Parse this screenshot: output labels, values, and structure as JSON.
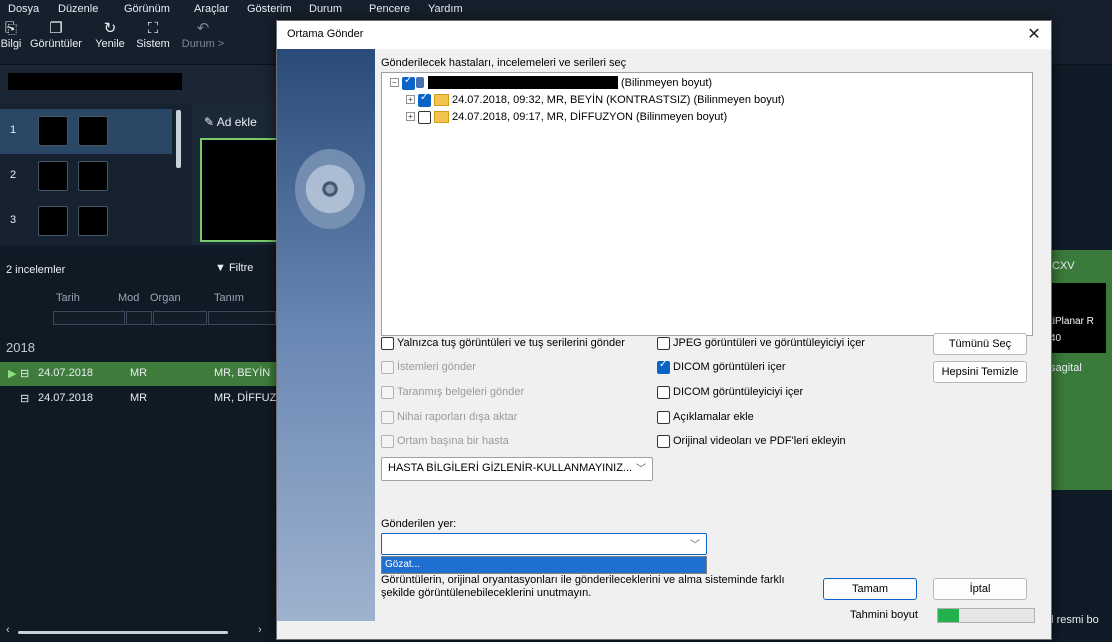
{
  "menu": [
    "Dosya",
    "Düzenle",
    "Görünüm",
    "Araçlar",
    "Gösterim",
    "Durum",
    "Pencere",
    "Yardım"
  ],
  "toolbar": {
    "bilgi": "Bilgi",
    "goruntuler": "Görüntüler",
    "yenile": "Yenile",
    "sistem": "Sistem",
    "durum": "Durum >"
  },
  "series": [
    "1",
    "2",
    "3"
  ],
  "viewer": {
    "add_label": "Ad ekle"
  },
  "study_list": {
    "count_label": "2 incelemler",
    "filter_label": "Filtre",
    "headers": [
      "Tarih",
      "Mod",
      "Organ",
      "Tanım"
    ],
    "year": "2018",
    "rows": [
      {
        "date": "24.07.2018",
        "mod": "MR",
        "desc": "MR, BEYİN"
      },
      {
        "date": "24.07.2018",
        "mod": "MR",
        "desc": "MR, DİFFUZ"
      }
    ]
  },
  "right_panel": {
    "label": "CXV",
    "line1": "tiPlanar R",
    "line2": "40",
    "line3": "sagital",
    "bottom": "ul resmi bo"
  },
  "dialog": {
    "title": "Ortama Gönder",
    "close": "✕",
    "select_label": "Gönderilecek hastaları, incelemeleri ve serileri seç",
    "tree": {
      "root_suffix": "(Bilinmeyen boyut)",
      "study1": "24.07.2018, 09:32, MR, BEYİN (KONTRASTSIZ) (Bilinmeyen boyut)",
      "study2": "24.07.2018, 09:17, MR, DİFFUZYON (Bilinmeyen boyut)"
    },
    "options_left": [
      {
        "label": "Yalnızca tuş görüntüleri ve tuş serilerini gönder",
        "checked": false,
        "disabled": false
      },
      {
        "label": "İstemleri gönder",
        "checked": false,
        "disabled": true
      },
      {
        "label": "Taranmış belgeleri gönder",
        "checked": false,
        "disabled": true
      },
      {
        "label": "Nihai raporları dışa aktar",
        "checked": false,
        "disabled": true
      },
      {
        "label": "Ortam başına bir hasta",
        "checked": false,
        "disabled": true
      }
    ],
    "options_right": [
      {
        "label": "JPEG görüntüleri ve görüntüleyiciyi içer",
        "checked": false
      },
      {
        "label": "DICOM görüntüleri içer",
        "checked": true
      },
      {
        "label": "DICOM görüntüleyiciyi içer",
        "checked": false
      },
      {
        "label": "Açıklamalar ekle",
        "checked": false
      },
      {
        "label": "Orijinal videoları ve PDF'leri ekleyin",
        "checked": false
      }
    ],
    "select_all": "Tümünü Seç",
    "clear_all": "Hepsini Temizle",
    "anonymize_value": "HASTA BİLGİLERİ GİZLENİR-KULLANMAYINIZ...",
    "dest_label": "Gönderilen yer:",
    "dest_value": "",
    "dest_option": "Gözat...",
    "note_line1": "Görüntülerin, orijinal oryantasyonları ile gönderileceklerini ve alma sisteminde farklı",
    "note_line2": "şekilde görüntülenebileceklerini unutmayın.",
    "ok": "Tamam",
    "cancel": "İptal",
    "size_label": "Tahmini boyut",
    "size_progress": 0.22
  }
}
